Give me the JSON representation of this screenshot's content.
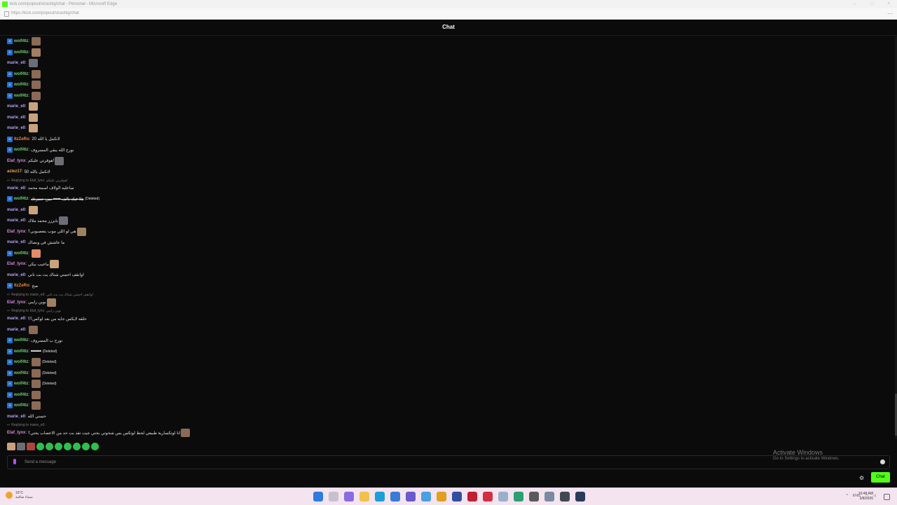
{
  "window": {
    "title": "kick.com/popout/sirashig/chat - Personal - Microsoft Edge",
    "url": "https://kick.com/popout/sirashig/chat"
  },
  "header": {
    "title": "Chat"
  },
  "colors": {
    "accent": "#53fc18",
    "wolf": "#6cd36a",
    "marie": "#b5a1f7",
    "elaf": "#d68bd6",
    "itzzero": "#f08a3a",
    "azlez": "#e8a84a"
  },
  "messages": [
    {
      "user": "wolf4tz",
      "badge": true,
      "color": "#6cd36a",
      "emote": "a"
    },
    {
      "user": "wolf4tz",
      "badge": true,
      "color": "#6cd36a",
      "emote": "b"
    },
    {
      "user": "marie_e0",
      "color": "#b5a1f7",
      "emote": "c"
    },
    {
      "user": "wolf4tz",
      "badge": true,
      "color": "#6cd36a",
      "emote": "a"
    },
    {
      "user": "wolf4tz",
      "badge": true,
      "color": "#6cd36a",
      "emote": "a"
    },
    {
      "user": "wolf4tz",
      "badge": true,
      "color": "#6cd36a",
      "emote": "a"
    },
    {
      "user": "marie_e0",
      "color": "#b5a1f7",
      "emote": "d"
    },
    {
      "user": "marie_e0",
      "color": "#b5a1f7",
      "emote": "d"
    },
    {
      "user": "marie_e0",
      "color": "#b5a1f7",
      "emote": "d"
    },
    {
      "user": "ItzZeRo",
      "badge": true,
      "color": "#f08a3a",
      "text": "لاتكمل يا الله 20"
    },
    {
      "user": "wolf4tz",
      "badge": true,
      "color": "#6cd36a",
      "text": "نورح الله يبقي المسروف"
    },
    {
      "user": "Elaf_lynx",
      "color": "#d68bd6",
      "text": "هوقرتي عليكم!",
      "emote": "c"
    },
    {
      "user": "azlez17",
      "color": "#e8a84a",
      "text": "لاتكمل يالله 50"
    },
    {
      "reply": "Replying to Elaf_lynx: هوقرتي عليكم!"
    },
    {
      "user": "marie_e0",
      "color": "#b5a1f7",
      "text": "ساعليه الولاف اسمة محمد"
    },
    {
      "user": "wolf4tz",
      "badge": true,
      "color": "#6cd36a",
      "text": "هلا فيك يالف ••••• مين حضرتك",
      "deleted": "(Deleted)",
      "struck": true
    },
    {
      "user": "marie_e0",
      "color": "#b5a1f7",
      "emote": "d"
    },
    {
      "user": "marie_e0",
      "color": "#b5a1f7",
      "text": "يايززز محمد ملاك",
      "emote": "c"
    },
    {
      "user": "Elaf_lynx",
      "color": "#d68bd6",
      "text": "هي لو اللي موب بتعصبوني؟",
      "emote": "b"
    },
    {
      "user": "marie_e0",
      "color": "#b5a1f7",
      "text": "ما عاشش في ونصاك"
    },
    {
      "user": "wolf4tz",
      "badge": true,
      "color": "#6cd36a",
      "emote": "e"
    },
    {
      "user": "Elaf_lynx",
      "color": "#d68bd6",
      "text": "ماعيب بيكي",
      "emote": "d"
    },
    {
      "user": "marie_e0",
      "color": "#b5a1f7",
      "text": "اوانقف احمتي شناك يت بت ناتي"
    },
    {
      "user": "ItzZeRo",
      "badge": true,
      "color": "#f08a3a",
      "text": "صح"
    },
    {
      "reply": "Replying to marie_e0: اوانقف احمتي شناك يت بت ناتي"
    },
    {
      "user": "Elaf_lynx",
      "color": "#d68bd6",
      "text": "بوين رايبي",
      "emote": "b"
    },
    {
      "reply": "Replying to Elaf_lynx: بوين رايبي"
    },
    {
      "user": "marie_e0",
      "color": "#b5a1f7",
      "text": "حلقه لايكس جايه من بعد لوكس؟؟"
    },
    {
      "user": "marie_e0",
      "color": "#b5a1f7",
      "emote": "a"
    },
    {
      "user": "wolf4tz",
      "badge": true,
      "color": "#6cd36a",
      "text": "نورح ب المسروف"
    },
    {
      "user": "wolf4tz",
      "badge": true,
      "color": "#6cd36a",
      "text": "•••••••",
      "deleted": "(Deleted)",
      "struck": true
    },
    {
      "user": "wolf4tz",
      "badge": true,
      "color": "#6cd36a",
      "emote": "a",
      "deleted": "(Deleted)"
    },
    {
      "user": "wolf4tz",
      "badge": true,
      "color": "#6cd36a",
      "emote": "a",
      "deleted": "(Deleted)"
    },
    {
      "user": "wolf4tz",
      "badge": true,
      "color": "#6cd36a",
      "emote": "a",
      "deleted": "(Deleted)"
    },
    {
      "user": "wolf4tz",
      "badge": true,
      "color": "#6cd36a",
      "emote": "a"
    },
    {
      "user": "wolf4tz",
      "badge": true,
      "color": "#6cd36a",
      "emote": "a"
    },
    {
      "user": "marie_e0",
      "color": "#b5a1f7",
      "text": "حسني الله"
    },
    {
      "reply": "Replying to marie_e0:"
    },
    {
      "user": "Elaf_lynx",
      "color": "#d68bd6",
      "text": "انا لوتكسارية طبيعي لحظ لوتكس بس شخوتي بحتي جيت تقد بت حد من الاعصاب بحتي؟",
      "emote": "a"
    }
  ],
  "input": {
    "placeholder": "Send a message"
  },
  "chat_button_label": "Chat",
  "watermark": {
    "line1": "Activate Windows",
    "line2": "Go to Settings to activate Windows."
  },
  "taskbar": {
    "weather_temp": "16°C",
    "weather_desc": "سماء صافية",
    "lang": "ENG",
    "time": "10:48 AM",
    "date": "3/8/2026"
  }
}
